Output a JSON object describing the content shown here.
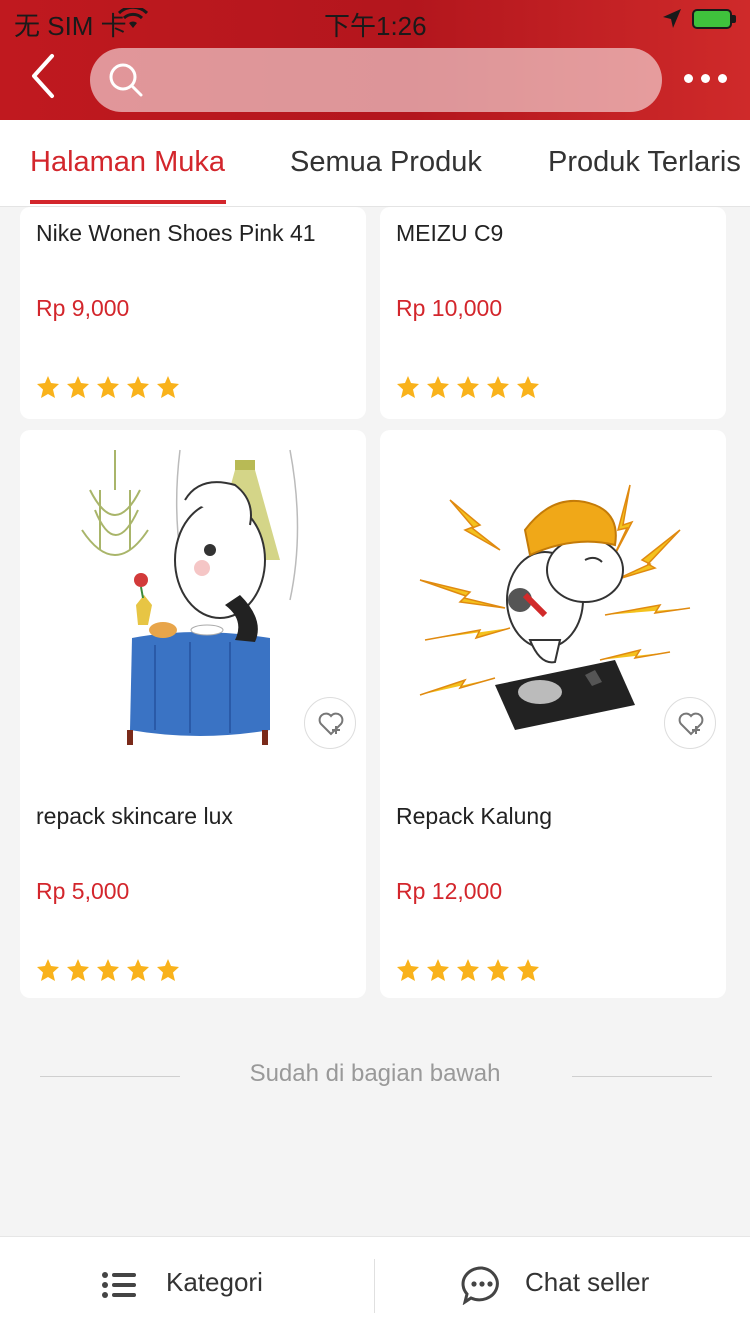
{
  "status_bar": {
    "carrier": "无 SIM 卡",
    "time": "下午1:26"
  },
  "search": {
    "placeholder": ""
  },
  "tabs": [
    {
      "label": "Halaman Muka",
      "active": true
    },
    {
      "label": "Semua Produk",
      "active": false
    },
    {
      "label": "Produk Terlaris",
      "active": false
    }
  ],
  "products": [
    {
      "name": "Nike Wonen Shoes Pink 41",
      "price": "Rp 9,000",
      "rating": 5
    },
    {
      "name": "MEIZU C9",
      "price": "Rp 10,000",
      "rating": 5
    },
    {
      "name": "repack skincare lux",
      "price": "Rp 5,000",
      "rating": 5
    },
    {
      "name": "Repack Kalung",
      "price": "Rp 12,000",
      "rating": 5
    }
  ],
  "footer_note": "Sudah di bagian bawah",
  "bottom_bar": {
    "kategori_label": "Kategori",
    "chat_label": "Chat seller"
  },
  "colors": {
    "brand_red": "#c0191f",
    "price_red": "#d3262c",
    "star": "#f9b21b"
  },
  "icons": [
    "back-icon",
    "search-icon",
    "more-icon",
    "star-icon",
    "favorite-add-icon",
    "list-icon",
    "chat-icon",
    "wifi-icon",
    "location-icon",
    "battery-icon"
  ]
}
